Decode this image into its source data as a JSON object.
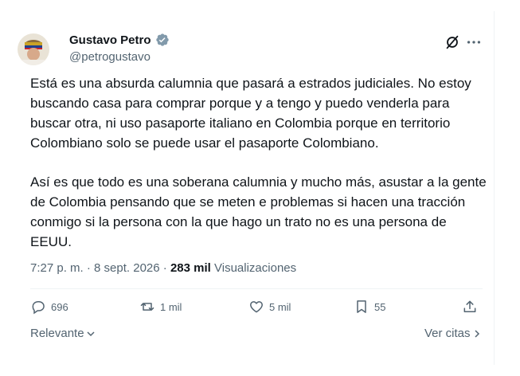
{
  "author": {
    "name": "Gustavo Petro",
    "handle": "@petrogustavo"
  },
  "tweet": {
    "paragraphs": [
      "Está es una absurda calumnia que pasará a estrados judiciales. No estoy buscando casa para comprar porque y a tengo y puedo venderla para buscar otra, ni uso pasaporte italiano en Colombia porque en territorio Colombiano solo se puede usar el pasaporte Colombiano.",
      "Así es que todo es una soberana calumnia y mucho más, asustar a la gente de Colombia pensando que se meten e problemas si hacen una tracción conmigo si la persona con la que hago un trato no es una persona de EEUU."
    ],
    "time": "7:27 p. m.",
    "separator1": "·",
    "date": "8 sept. 2026",
    "separator2": "·",
    "views_count": "283 mil",
    "views_label": "Visualizaciones"
  },
  "actions": {
    "replies": "696",
    "reposts": "1 mil",
    "likes": "5 mil",
    "bookmarks": "55"
  },
  "footer": {
    "sort_label": "Relevante",
    "quotes_label": "Ver citas"
  },
  "colors": {
    "text": "#0f1419",
    "secondary": "#536471",
    "verified": "#829aab"
  },
  "icons": {
    "verified": "verified-badge-icon",
    "grok": "grok-icon",
    "more": "more-icon",
    "reply": "reply-icon",
    "repost": "repost-icon",
    "like": "heart-icon",
    "bookmark": "bookmark-icon",
    "share": "share-icon"
  }
}
